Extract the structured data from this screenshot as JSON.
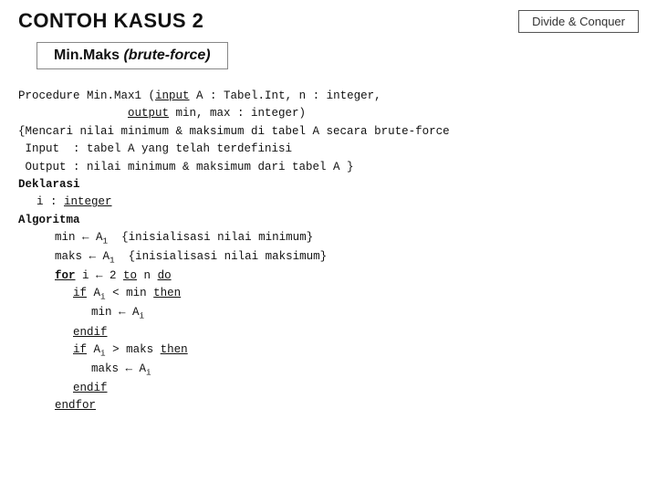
{
  "header": {
    "title": "CONTOH KASUS 2",
    "badge": "Divide & Conquer"
  },
  "subtitle": {
    "label": "Min.Maks",
    "italic_part": "(brute-force)"
  },
  "code": {
    "lines": []
  }
}
